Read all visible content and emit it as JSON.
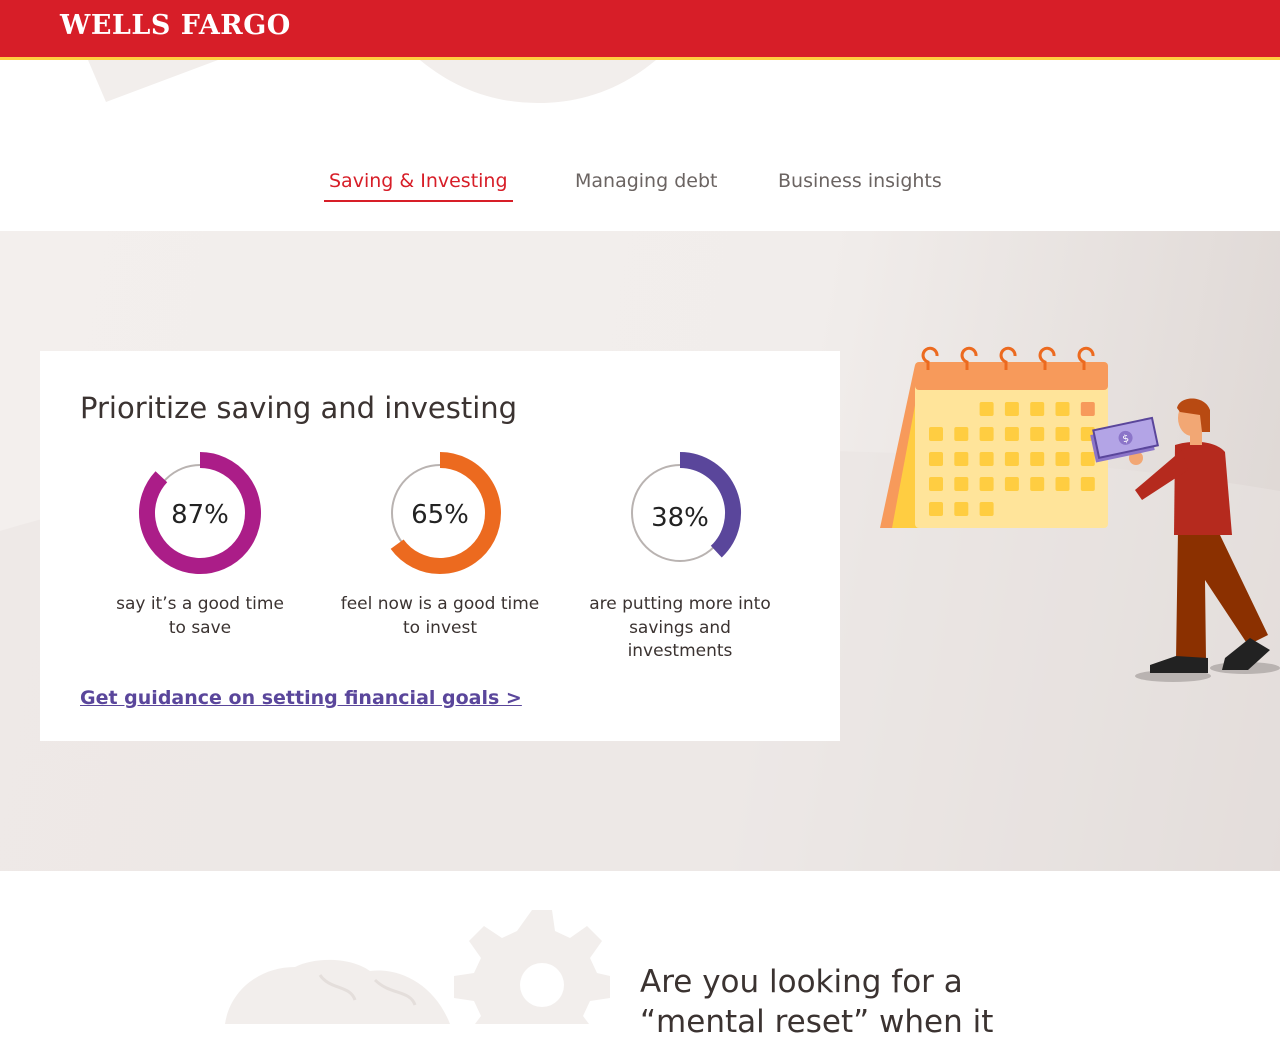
{
  "header": {
    "logo_text": "WELLS FARGO",
    "brand_color": "#d71e28",
    "accent_color": "#ffcd41"
  },
  "tabs": [
    {
      "label": "Saving & Investing",
      "active": true
    },
    {
      "label": "Managing debt",
      "active": false
    },
    {
      "label": "Business insights",
      "active": false
    }
  ],
  "card": {
    "title": "Prioritize saving and investing",
    "stats": [
      {
        "value": "87%",
        "percent": 87,
        "color": "#ab1d88",
        "label_lines": [
          "say it’s a good time",
          "to save"
        ]
      },
      {
        "value": "65%",
        "percent": 65,
        "color": "#ec6a1f",
        "label_lines": [
          "feel now is a good time",
          "to invest"
        ]
      },
      {
        "value": "38%",
        "percent": 38,
        "color": "#5a469b",
        "label_lines": [
          "are putting more into",
          "savings and",
          "investments"
        ]
      }
    ],
    "link_text": "Get guidance on setting financial goals >"
  },
  "illustration": {
    "dollar_sign": "$"
  },
  "bottom": {
    "heading_lines": [
      "Are you looking for a",
      "“mental reset” when it"
    ]
  },
  "icons": [
    "calendar-icon",
    "person-with-money-icon",
    "brain-icon",
    "gear-icon"
  ]
}
